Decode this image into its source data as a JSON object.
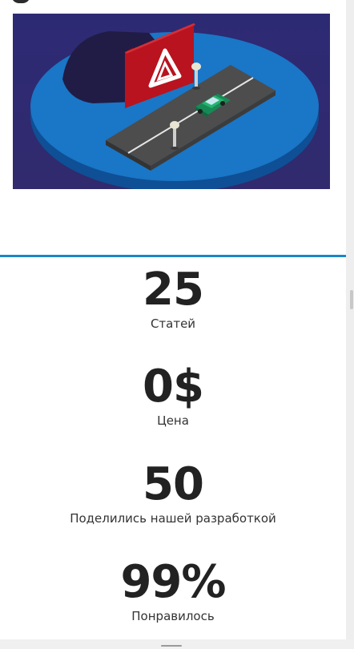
{
  "hero": {
    "illustration": "hazard-road-illustration",
    "colors": {
      "background": "#2d2a74",
      "platform": "#1976c8",
      "panel": "#b2131f",
      "road": "#555555",
      "car": "#1fa463"
    }
  },
  "stats": [
    {
      "value": "25",
      "label": "Статей"
    },
    {
      "value": "0$",
      "label": "Цена"
    },
    {
      "value": "50",
      "label": "Поделились нашей разработкой"
    },
    {
      "value": "99%",
      "label": "Понравилось"
    }
  ],
  "accent_color": "#1a86c8"
}
